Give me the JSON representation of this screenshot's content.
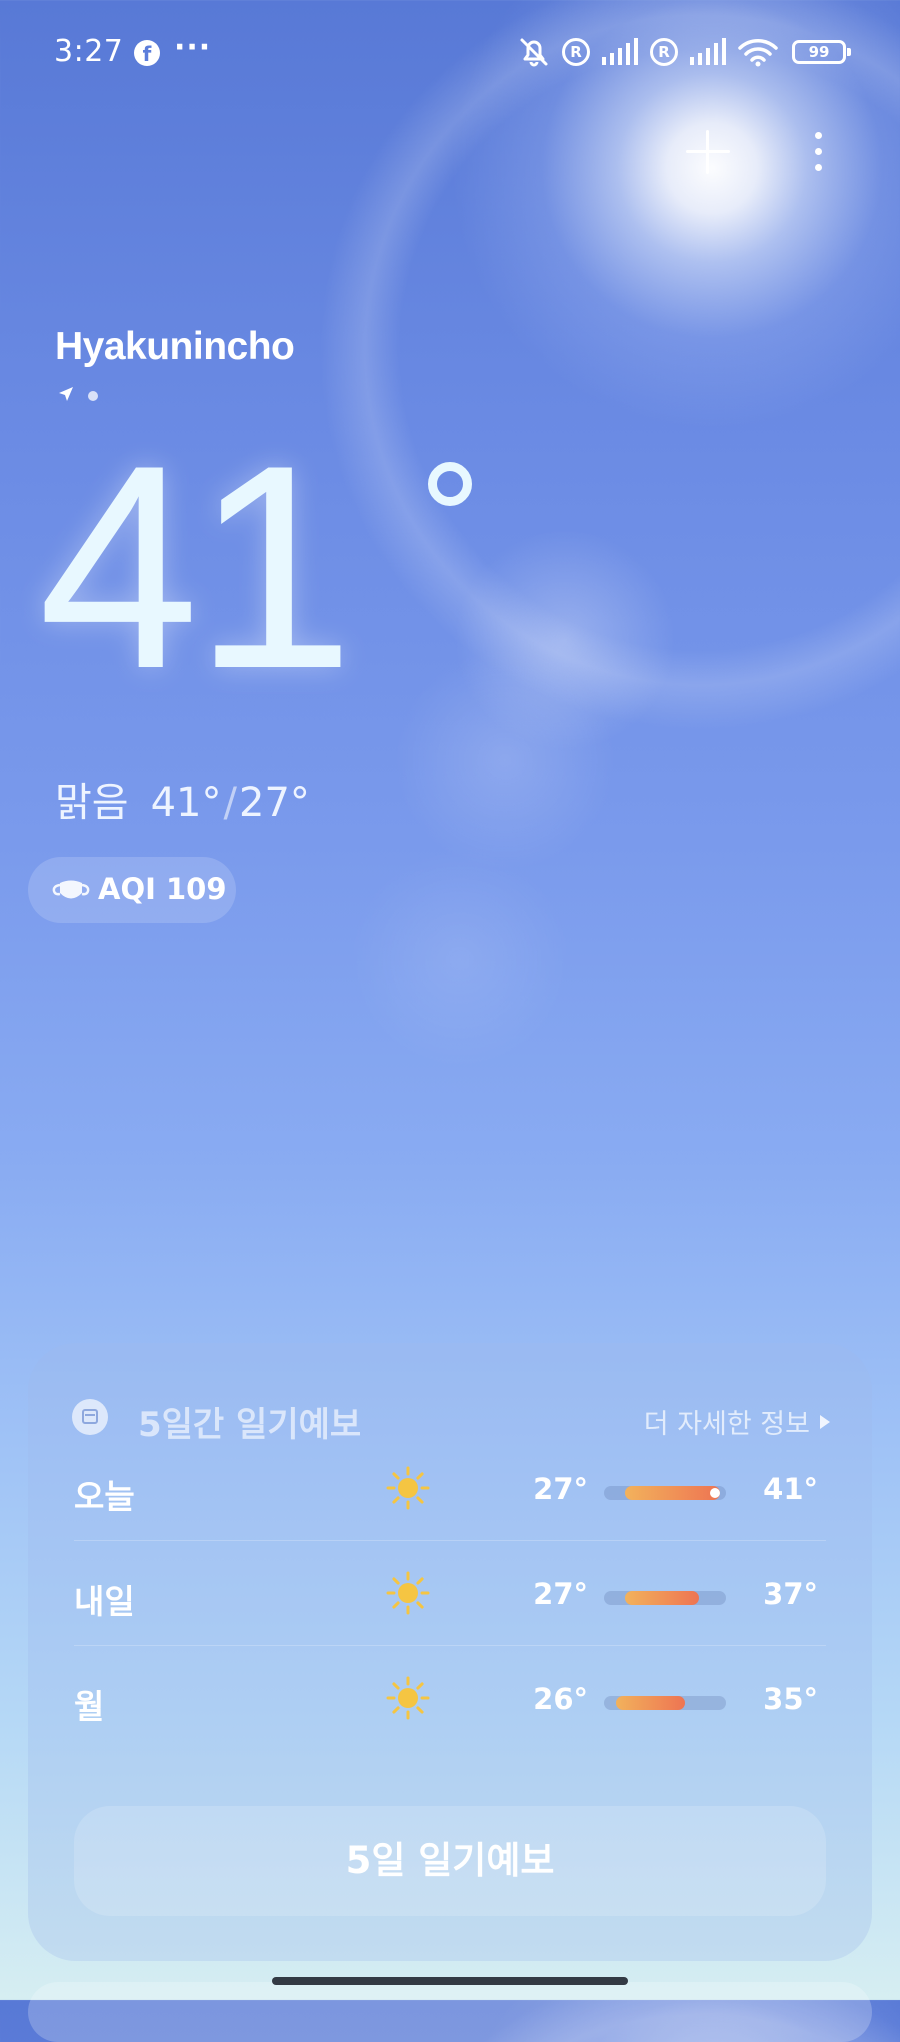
{
  "status_bar": {
    "time": "3:27",
    "app_icons": [
      "facebook-icon",
      "more-notifications-icon"
    ],
    "system_icons": [
      "muted-bell-icon",
      "registered-icon",
      "signal-icon",
      "registered-icon",
      "signal-icon",
      "wifi-icon",
      "battery-icon"
    ],
    "more_glyph": "···",
    "fb_glyph": "f",
    "reg_glyph": "R",
    "battery_level": "99"
  },
  "header": {
    "location": "Hyakunincho",
    "location_icon": "location-arrow-icon"
  },
  "current": {
    "temperature": "41",
    "condition": "맑음",
    "high": "41°",
    "low": "27°",
    "separator": "/"
  },
  "aqi": {
    "label": "AQI 109",
    "icon": "mask-icon"
  },
  "forecast": {
    "title": "5일간 일기예보",
    "more_label": "더 자세한 정보",
    "button_label": "5일 일기예보",
    "days": [
      {
        "day": "오늘",
        "icon": "sun-icon",
        "low": "27°",
        "high": "41°",
        "range_start": 0.17,
        "range_end": 0.95,
        "current_marker": true
      },
      {
        "day": "내일",
        "icon": "sun-icon",
        "low": "27°",
        "high": "37°",
        "range_start": 0.17,
        "range_end": 0.78,
        "current_marker": false
      },
      {
        "day": "월",
        "icon": "sun-icon",
        "low": "26°",
        "high": "35°",
        "range_start": 0.1,
        "range_end": 0.66,
        "current_marker": false
      }
    ]
  },
  "colors": {
    "sky_top": "#5879d6",
    "sky_bottom": "#d6eef2",
    "sun": "#f5c542",
    "bar_warm": "#f2b25c",
    "bar_hot": "#ee7452"
  }
}
